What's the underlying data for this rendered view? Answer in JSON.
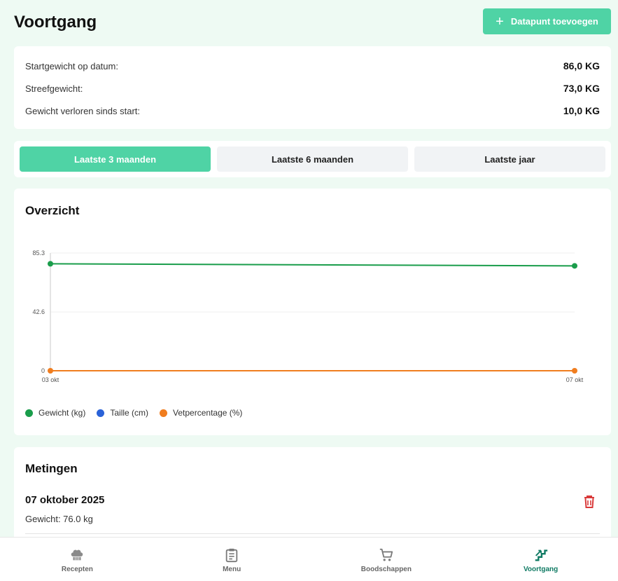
{
  "header": {
    "title": "Voortgang",
    "add_button_label": "Datapunt toevoegen",
    "add_icon": "plus-icon"
  },
  "stats": [
    {
      "label": "Startgewicht op datum:",
      "value": "86,0 KG"
    },
    {
      "label": "Streefgewicht:",
      "value": "73,0 KG"
    },
    {
      "label": "Gewicht verloren sinds start:",
      "value": "10,0 KG"
    }
  ],
  "ranges": [
    {
      "label": "Laatste 3 maanden",
      "active": true
    },
    {
      "label": "Laatste 6 maanden",
      "active": false
    },
    {
      "label": "Laatste jaar",
      "active": false
    }
  ],
  "overview": {
    "title": "Overzicht"
  },
  "colors": {
    "accent": "#4fd3a5",
    "gewicht": "#1a9d4b",
    "taille": "#2a62d8",
    "vet": "#f07d1f",
    "delete": "#d93a3a",
    "nav_active": "#0f7a63"
  },
  "chart_data": {
    "type": "line",
    "categories": [
      "03 okt",
      "07 okt"
    ],
    "y_ticks": [
      "85.3",
      "42.6",
      "0"
    ],
    "ylim": [
      0,
      85.3
    ],
    "grid": true,
    "legend_position": "bottom-left",
    "series": [
      {
        "name": "Gewicht (kg)",
        "values": [
          77.5,
          76.0
        ],
        "color": "#1a9d4b"
      },
      {
        "name": "Taille (cm)",
        "values": [],
        "color": "#2a62d8"
      },
      {
        "name": "Vetpercentage (%)",
        "values": [
          0,
          0
        ],
        "color": "#f07d1f"
      }
    ]
  },
  "metingen": {
    "title": "Metingen",
    "entries": [
      {
        "date": "07 oktober 2025",
        "detail": "Gewicht: 76.0 kg",
        "delete_icon": "trash-icon"
      }
    ]
  },
  "nav": {
    "items": [
      {
        "label": "Recepten",
        "icon": "chef-hat-icon",
        "active": false
      },
      {
        "label": "Menu",
        "icon": "clipboard-icon",
        "active": false
      },
      {
        "label": "Boodschappen",
        "icon": "cart-icon",
        "active": false
      },
      {
        "label": "Voortgang",
        "icon": "progress-stairs-icon",
        "active": true
      }
    ]
  }
}
